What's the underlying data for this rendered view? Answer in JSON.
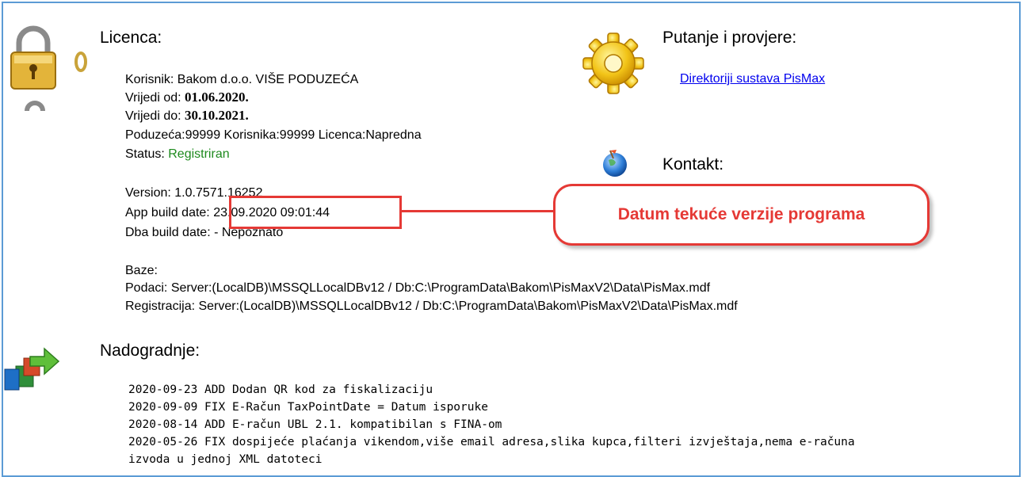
{
  "licenca": {
    "heading": "Licenca:",
    "korisnik": "Korisnik: Bakom d.o.o. VIŠE PODUZEĆA",
    "vrijedi_od_label": "Vrijedi od: ",
    "vrijedi_od_value": "01.06.2020.",
    "vrijedi_do_label": "Vrijedi do: ",
    "vrijedi_do_value": "30.10.2021.",
    "poduzeca": "Poduzeća:99999 Korisnika:99999 Licenca:Napredna",
    "status_label": "Status: ",
    "status_value": "Registriran",
    "version": "Version: 1.0.7571.16252",
    "app_build_label": "App build date: ",
    "app_build_value": "23.09.2020 09:01:44",
    "dba_build": "Dba build date:  - Nepoznato",
    "baze_label": "Baze:",
    "podaci": "Podaci: Server:(LocalDB)\\MSSQLLocalDBv12 / Db:C:\\ProgramData\\Bakom\\PisMaxV2\\Data\\PisMax.mdf",
    "registracija": "Registracija: Server:(LocalDB)\\MSSQLLocalDBv12 / Db:C:\\ProgramData\\Bakom\\PisMaxV2\\Data\\PisMax.mdf"
  },
  "putanje": {
    "heading": "Putanje i provjere:",
    "link": "Direktoriji sustava PisMax "
  },
  "kontakt": {
    "heading": "Kontakt:"
  },
  "callout": {
    "text": "Datum tekuće verzije programa"
  },
  "nadogradnje": {
    "heading": "Nadogradnje:",
    "lines": [
      "2020-09-23 ADD Dodan QR kod za fiskalizaciju",
      "2020-09-09 FIX E-Račun TaxPointDate = Datum isporuke",
      "2020-08-14 ADD E-račun UBL 2.1. kompatibilan s FINA-om",
      "2020-05-26 FIX dospijeće plaćanja vikendom,više email adresa,slika kupca,filteri izvještaja,nema e-računa",
      "izvoda u jednoj XML datoteci"
    ]
  },
  "colors": {
    "accent_red": "#e53935",
    "status_green": "#1e8a1e",
    "link_blue": "#0000ee",
    "frame_blue": "#5b9bd5"
  }
}
